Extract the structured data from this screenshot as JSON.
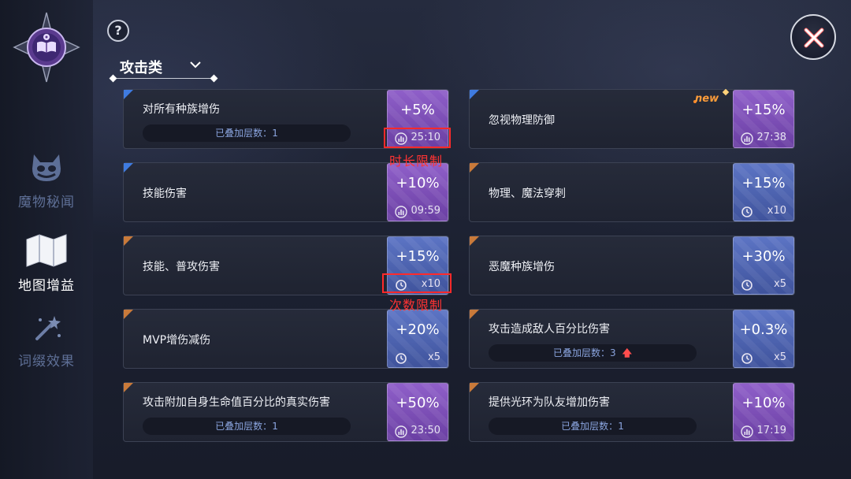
{
  "nav": {
    "items": [
      {
        "label": "魔物秘闻",
        "state": "dim",
        "icon": "demon-face-icon"
      },
      {
        "label": "地图增益",
        "state": "active",
        "icon": "map-icon"
      },
      {
        "label": "词缀效果",
        "state": "dim",
        "icon": "magic-wand-icon"
      }
    ]
  },
  "help": {
    "label": "?"
  },
  "dropdown": {
    "selected": "攻击类"
  },
  "badge_new": "new",
  "annotations": {
    "duration_limit": "时长限制",
    "count_limit": "次数限制"
  },
  "colors": {
    "purple_tile": "#7c4fb7",
    "blue_tile": "#4c63b0",
    "blue_corner": "#3f7be0",
    "orange_corner": "#c97a3a",
    "annotation_red": "#ff2a2a",
    "stack_text": "#8aa4de"
  },
  "buffs": [
    {
      "name": "对所有种族增伤",
      "stack_label": "已叠加层数：",
      "stack_count": "1",
      "value": "+5%",
      "limit_type": "time",
      "limit": "25:10",
      "tile": "purple",
      "corner": "blue"
    },
    {
      "name": "忽视物理防御",
      "value": "+15%",
      "limit_type": "time",
      "limit": "27:38",
      "tile": "purple",
      "corner": "blue",
      "is_new": true
    },
    {
      "name": "技能伤害",
      "value": "+10%",
      "limit_type": "time",
      "limit": "09:59",
      "tile": "purple",
      "corner": "blue"
    },
    {
      "name": "物理、魔法穿刺",
      "value": "+15%",
      "limit_type": "count",
      "limit": "x10",
      "tile": "blue",
      "corner": "orange"
    },
    {
      "name": "技能、普攻伤害",
      "value": "+15%",
      "limit_type": "count",
      "limit": "x10",
      "tile": "blue",
      "corner": "orange"
    },
    {
      "name": "恶魔种族增伤",
      "value": "+30%",
      "limit_type": "count",
      "limit": "x5",
      "tile": "blue",
      "corner": "orange"
    },
    {
      "name": "MVP增伤减伤",
      "value": "+20%",
      "limit_type": "count",
      "limit": "x5",
      "tile": "blue",
      "corner": "orange"
    },
    {
      "name": "攻击造成敌人百分比伤害",
      "stack_label": "已叠加层数：",
      "stack_count": "3",
      "stack_arrow": "🡅",
      "value": "+0.3%",
      "limit_type": "count",
      "limit": "x5",
      "tile": "blue",
      "corner": "orange"
    },
    {
      "name": "攻击附加自身生命值百分比的真实伤害",
      "stack_label": "已叠加层数：",
      "stack_count": "1",
      "value": "+50%",
      "limit_type": "time",
      "limit": "23:50",
      "tile": "purple",
      "corner": "orange"
    },
    {
      "name": "提供光环为队友增加伤害",
      "stack_label": "已叠加层数：",
      "stack_count": "1",
      "value": "+10%",
      "limit_type": "time",
      "limit": "17:19",
      "tile": "purple",
      "corner": "orange"
    }
  ]
}
